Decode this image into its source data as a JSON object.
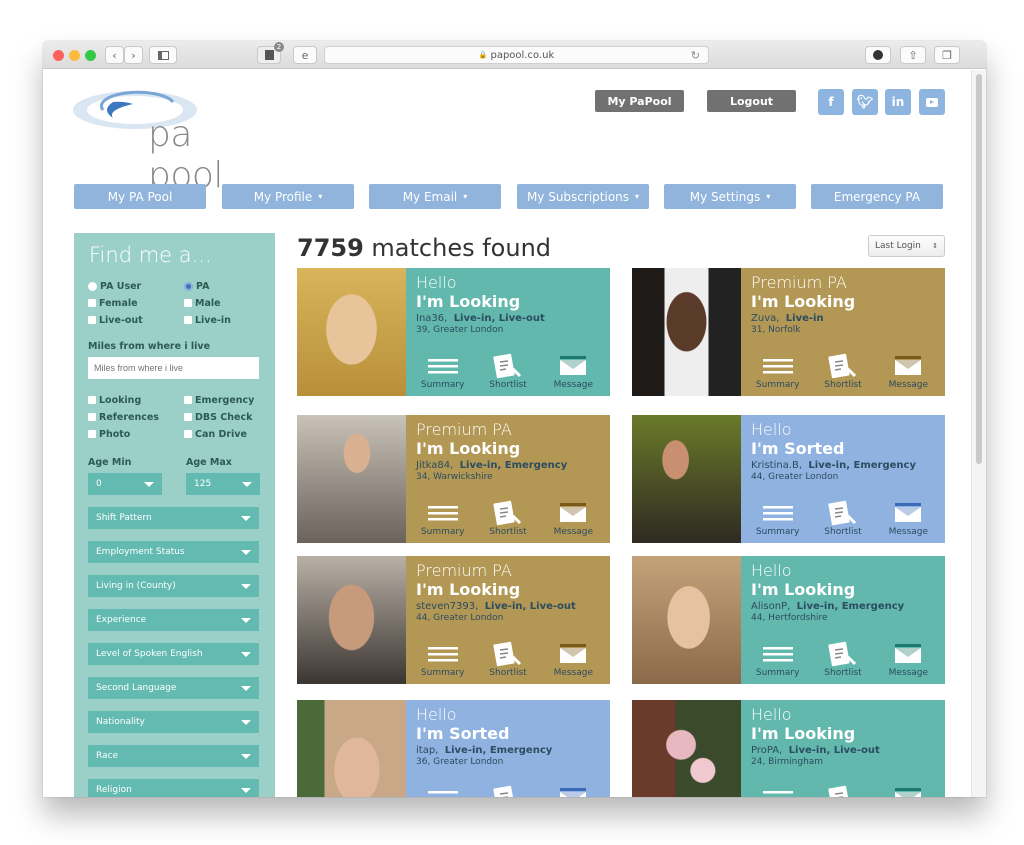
{
  "browser": {
    "url": "papool.co.uk",
    "reader_badge": "2"
  },
  "header": {
    "logo_text": "pa pool",
    "buttons": [
      {
        "label": "My PaPool"
      },
      {
        "label": "Logout"
      }
    ],
    "social": [
      {
        "name": "facebook",
        "glyph": "f"
      },
      {
        "name": "twitter",
        "glyph": "t"
      },
      {
        "name": "linkedin",
        "glyph": "in"
      },
      {
        "name": "youtube",
        "glyph": "▶"
      }
    ]
  },
  "nav": [
    {
      "label": "My PA Pool",
      "dropdown": false
    },
    {
      "label": "My Profile",
      "dropdown": true
    },
    {
      "label": "My Email",
      "dropdown": true
    },
    {
      "label": "My Subscriptions",
      "dropdown": true
    },
    {
      "label": "My Settings",
      "dropdown": true
    },
    {
      "label": "Emergency PA",
      "dropdown": false
    }
  ],
  "sidebar": {
    "title": "Find me a...",
    "radios": [
      {
        "label": "PA User",
        "checked": false
      },
      {
        "label": "PA",
        "checked": true
      }
    ],
    "checks_top": [
      {
        "label": "Female"
      },
      {
        "label": "Male"
      },
      {
        "label": "Live-out"
      },
      {
        "label": "Live-in"
      }
    ],
    "miles_label": "Miles from where i live",
    "miles_placeholder": "Miles from where i live",
    "checks_bottom": [
      {
        "label": "Looking"
      },
      {
        "label": "Emergency"
      },
      {
        "label": "References"
      },
      {
        "label": "DBS Check"
      },
      {
        "label": "Photo"
      },
      {
        "label": "Can Drive"
      }
    ],
    "age_min_label": "Age Min",
    "age_min_value": "0",
    "age_max_label": "Age Max",
    "age_max_value": "125",
    "selects": [
      "Shift Pattern",
      "Employment Status",
      "Living in (County)",
      "Experience",
      "Level of Spoken English",
      "Second Language",
      "Nationality",
      "Race",
      "Religion"
    ]
  },
  "results": {
    "count": "7759",
    "count_suffix": " matches found",
    "sort_value": "Last Login",
    "actions": [
      "Summary",
      "Shortlist",
      "Message"
    ]
  },
  "colors": {
    "teal": "#62b8ad",
    "gold": "#b39754",
    "blue": "#8fb2e0",
    "sidebar": "#9bd0c8",
    "nav": "#90b4db"
  },
  "cards": [
    {
      "greeting": "Hello",
      "status": "I'm Looking",
      "username": "Ina36",
      "tags": "Live-in, Live-out",
      "location": "39, Greater London",
      "theme": "teal"
    },
    {
      "greeting": "Premium PA",
      "status": "I'm Looking",
      "username": "Zuva",
      "tags": "Live-in",
      "location": "31, Norfolk",
      "theme": "gold"
    },
    {
      "greeting": "Premium PA",
      "status": "I'm Looking",
      "username": "Jitka84",
      "tags": "Live-in, Emergency",
      "location": "34, Warwickshire",
      "theme": "gold"
    },
    {
      "greeting": "Hello",
      "status": "I'm Sorted",
      "username": "Kristina.B",
      "tags": "Live-in, Emergency",
      "location": "44, Greater London",
      "theme": "blue"
    },
    {
      "greeting": "Premium PA",
      "status": "I'm Looking",
      "username": "steven7393",
      "tags": "Live-in, Live-out",
      "location": "44, Greater London",
      "theme": "gold"
    },
    {
      "greeting": "Hello",
      "status": "I'm Looking",
      "username": "AlisonP",
      "tags": "Live-in, Emergency",
      "location": "44, Hertfordshire",
      "theme": "teal"
    },
    {
      "greeting": "Hello",
      "status": "I'm Sorted",
      "username": "itap",
      "tags": "Live-in, Emergency",
      "location": "36, Greater London",
      "theme": "blue"
    },
    {
      "greeting": "Hello",
      "status": "I'm Looking",
      "username": "ProPA",
      "tags": "Live-in, Live-out",
      "location": "24, Birmingham",
      "theme": "teal"
    }
  ]
}
